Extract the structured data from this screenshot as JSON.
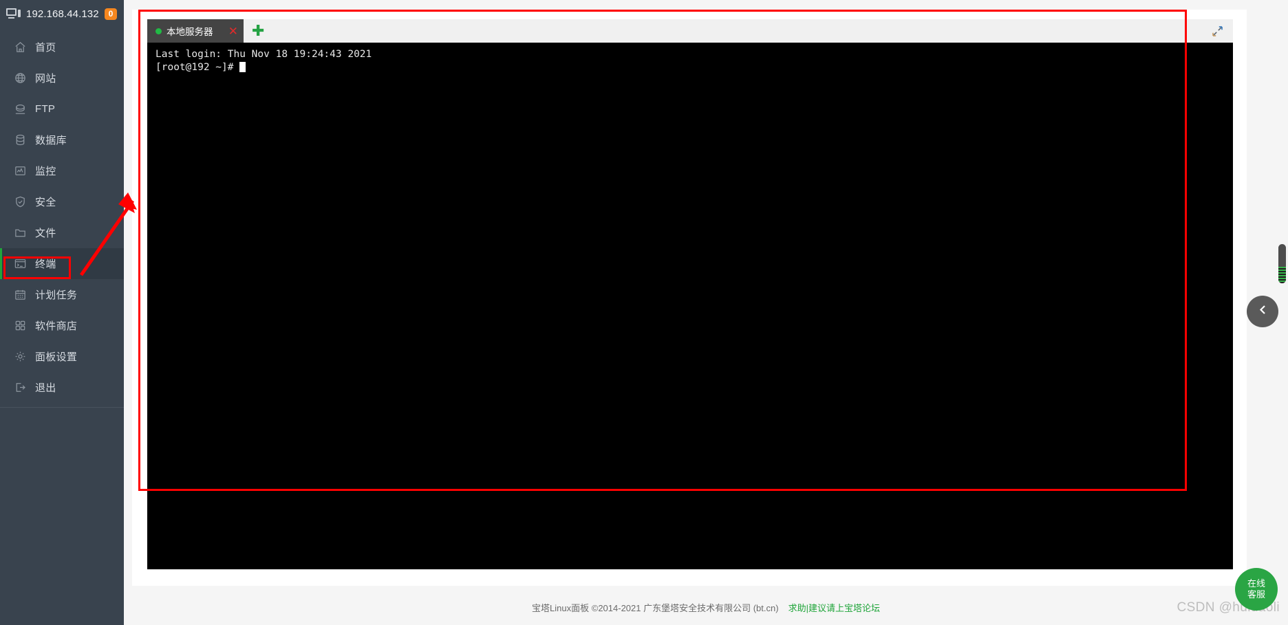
{
  "sidebar": {
    "header": {
      "icon": "monitor-icon",
      "ip": "192.168.44.132",
      "badge": "0"
    },
    "items": [
      {
        "label": "首页",
        "icon": "home-icon",
        "active": false
      },
      {
        "label": "网站",
        "icon": "globe-icon",
        "active": false
      },
      {
        "label": "FTP",
        "icon": "ftp-icon",
        "active": false
      },
      {
        "label": "数据库",
        "icon": "database-icon",
        "active": false
      },
      {
        "label": "监控",
        "icon": "monitor-chart-icon",
        "active": false
      },
      {
        "label": "安全",
        "icon": "shield-icon",
        "active": false
      },
      {
        "label": "文件",
        "icon": "folder-icon",
        "active": false
      },
      {
        "label": "终端",
        "icon": "terminal-icon",
        "active": true
      },
      {
        "label": "计划任务",
        "icon": "calendar-icon",
        "active": false
      },
      {
        "label": "软件商店",
        "icon": "grid-icon",
        "active": false
      },
      {
        "label": "面板设置",
        "icon": "gear-icon",
        "active": false
      },
      {
        "label": "退出",
        "icon": "logout-icon",
        "active": false
      }
    ]
  },
  "terminal": {
    "tab": {
      "status_dot_color": "#21ba45",
      "name": "本地服务器",
      "close_label": "✕"
    },
    "add_tab_label": "✚",
    "expand_icon": "expand-fullscreen-icon",
    "lines": [
      "Last login: Thu Nov 18 19:24:43 2021",
      "[root@192 ~]# "
    ]
  },
  "footer": {
    "text": "宝塔Linux面板 ©2014-2021 广东堡塔安全技术有限公司 (bt.cn)",
    "link": "求助|建议请上宝塔论坛"
  },
  "watermark": "CSDN @huidaoli",
  "widgets": {
    "support_button": {
      "line1": "在线",
      "line2": "客服",
      "color": "#2aa544"
    },
    "collapse_button": {
      "icon": "chevron-left-icon"
    }
  },
  "annotations": {
    "highlight_color": "#ff0000",
    "terminal_box": true,
    "menu_box": true,
    "arrow": true
  }
}
